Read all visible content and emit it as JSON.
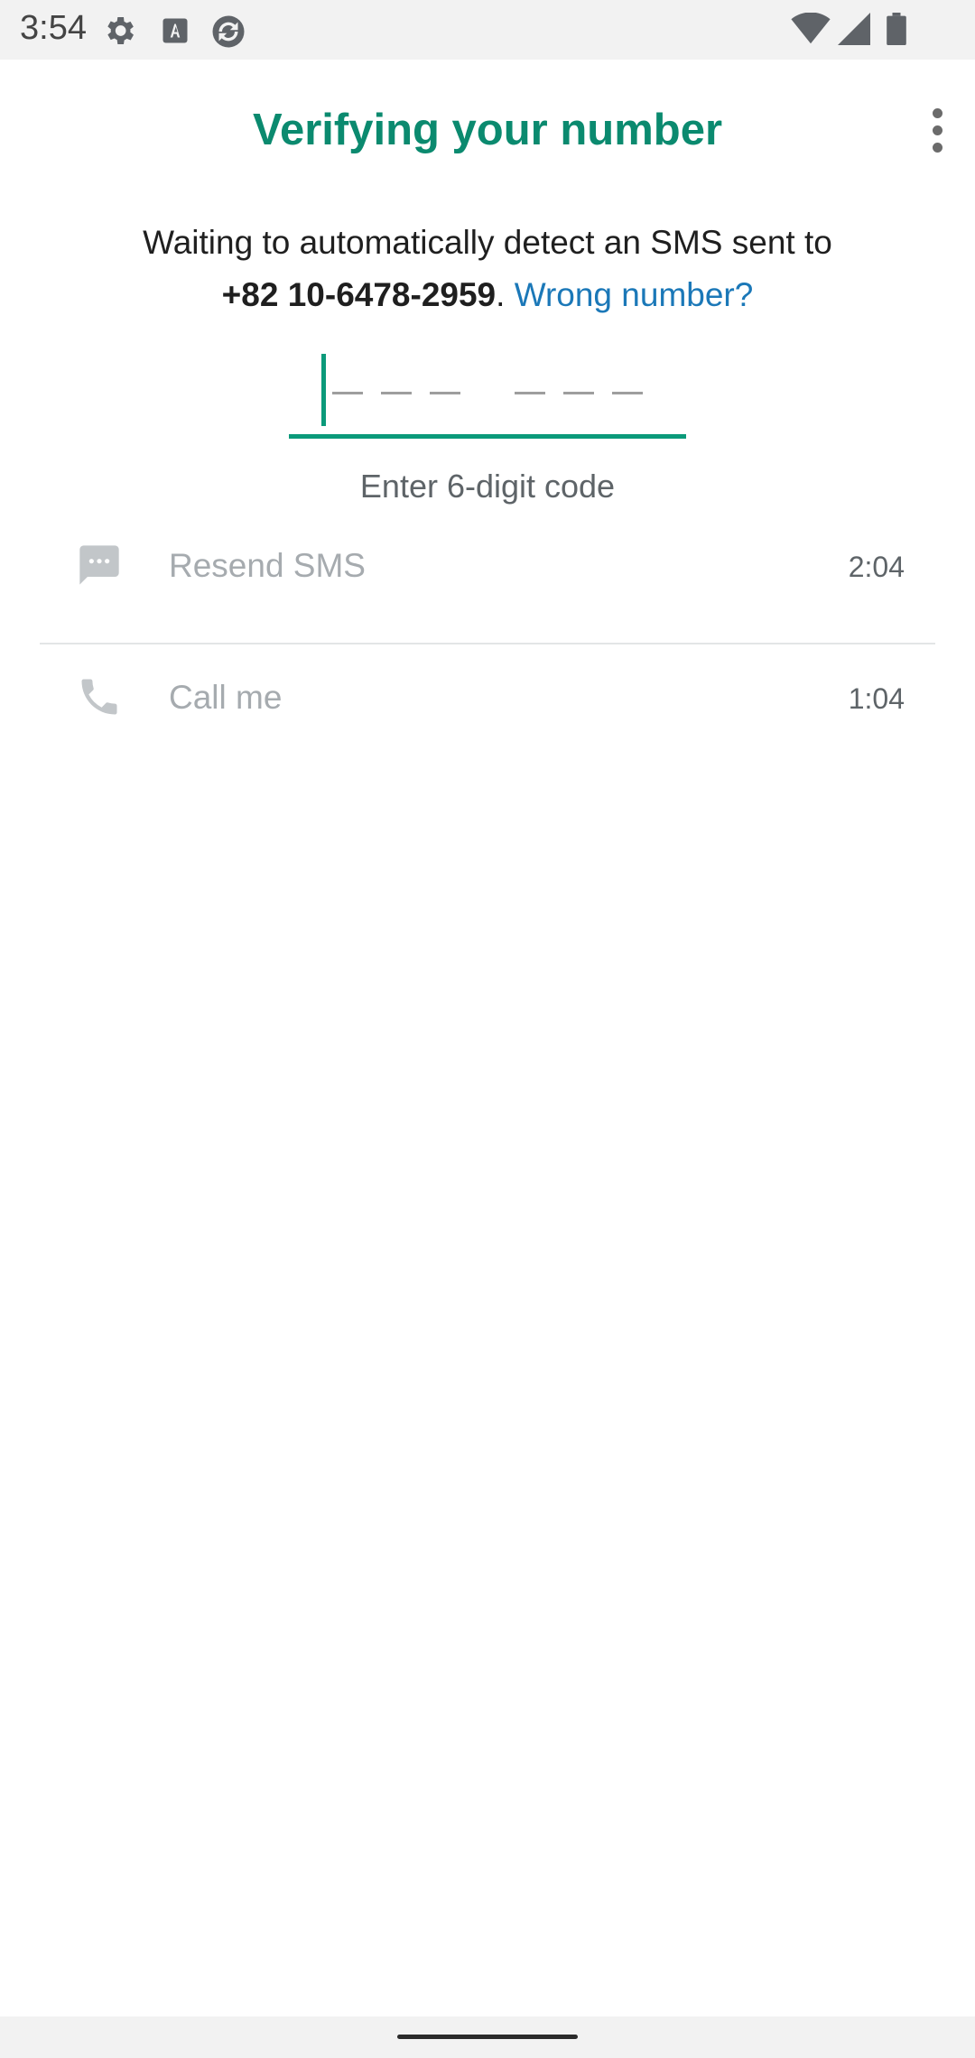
{
  "status_bar": {
    "time": "3:54",
    "icons": [
      "gear-icon",
      "font-a-icon",
      "sync-icon",
      "wifi-icon",
      "signal-icon",
      "battery-icon"
    ]
  },
  "header": {
    "title": "Verifying your number",
    "menu_icon": "more-vert-icon"
  },
  "verification": {
    "message": "Waiting to automatically detect an SMS sent to",
    "phone_number": "+82 10-6478-2959",
    "separator": ".",
    "wrong_number_link": "Wrong number?",
    "code_value": "",
    "code_hint": "Enter 6-digit code"
  },
  "actions": [
    {
      "icon": "message-icon",
      "label": "Resend SMS",
      "timer": "2:04"
    },
    {
      "icon": "phone-icon",
      "label": "Call me",
      "timer": "1:04"
    }
  ],
  "colors": {
    "accent": "#0b8a6f",
    "link": "#1b78b8",
    "disabled_text": "#a6abaf"
  }
}
